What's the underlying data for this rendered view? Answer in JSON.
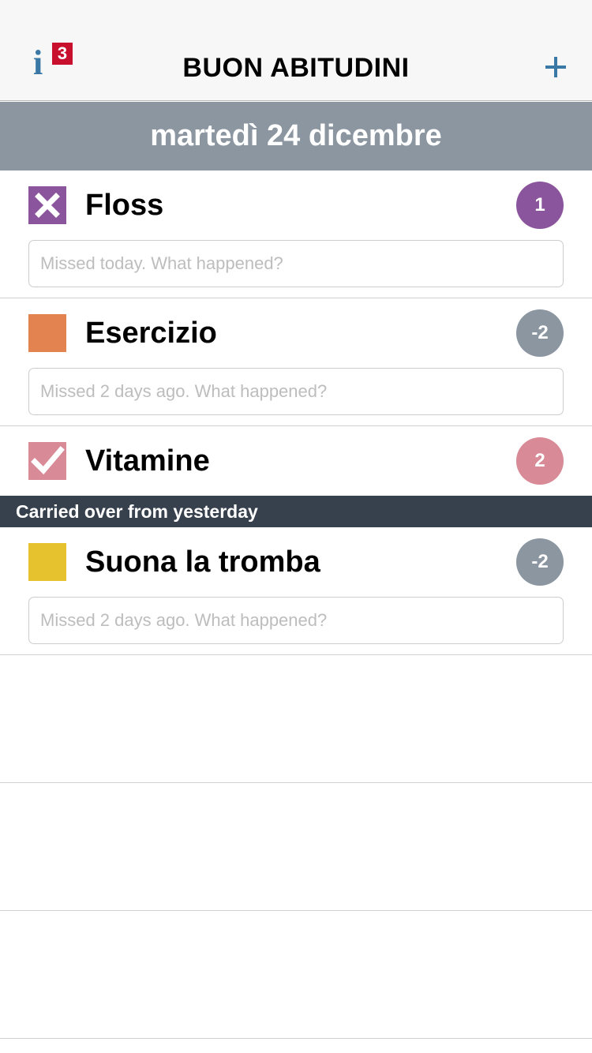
{
  "navbar": {
    "title": "BUON ABITUDINI",
    "info_icon": "info-icon",
    "info_badge": "3",
    "add_icon": "plus-icon"
  },
  "date_header": "martedì 24 dicembre",
  "habits": [
    {
      "name": "Floss",
      "status": "missed",
      "status_icon": "x-mark-icon",
      "color": "#8a559c",
      "counter": "1",
      "counter_color": "#8a559c",
      "note_placeholder": "Missed today. What happened?",
      "note_value": ""
    },
    {
      "name": "Esercizio",
      "status": "pending",
      "status_icon": "empty-square-icon",
      "color": "#e3834f",
      "counter": "-2",
      "counter_color": "#8b96a1",
      "note_placeholder": "Missed 2 days ago. What happened?",
      "note_value": ""
    },
    {
      "name": "Vitamine",
      "status": "done",
      "status_icon": "checkmark-icon",
      "color": "#d88a96",
      "counter": "2",
      "counter_color": "#d88a96"
    }
  ],
  "carried_over": {
    "label": "Carried over from yesterday",
    "habits": [
      {
        "name": "Suona la tromba",
        "status": "pending",
        "status_icon": "empty-square-icon",
        "color": "#e6c22e",
        "counter": "-2",
        "counter_color": "#8b96a1",
        "note_placeholder": "Missed 2 days ago. What happened?",
        "note_value": ""
      }
    ]
  }
}
